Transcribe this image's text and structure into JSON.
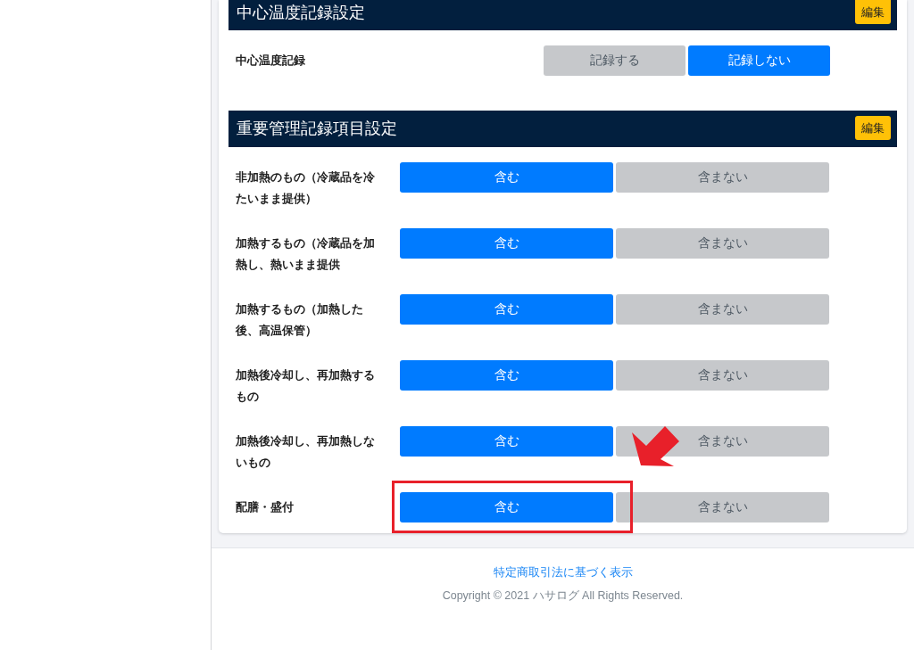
{
  "sections": [
    {
      "kind": "narrow",
      "title": "中心温度記録設定",
      "edit_button": "編集",
      "rows": [
        {
          "label": "中心温度記録",
          "options": [
            {
              "label": "記録する",
              "selected": false
            },
            {
              "label": "記録しない",
              "selected": true
            }
          ]
        }
      ]
    },
    {
      "kind": "wide",
      "title": "重要管理記録項目設定",
      "edit_button": "編集",
      "rows": [
        {
          "label": "非加熱のもの（冷蔵品を冷たいまま提供）",
          "options": [
            {
              "label": "含む",
              "selected": true
            },
            {
              "label": "含まない",
              "selected": false
            }
          ]
        },
        {
          "label": "加熱するもの（冷蔵品を加熱し、熱いまま提供",
          "options": [
            {
              "label": "含む",
              "selected": true
            },
            {
              "label": "含まない",
              "selected": false
            }
          ]
        },
        {
          "label": "加熱するもの（加熱した後、高温保管）",
          "options": [
            {
              "label": "含む",
              "selected": true
            },
            {
              "label": "含まない",
              "selected": false
            }
          ]
        },
        {
          "label": "加熱後冷却し、再加熱するもの",
          "options": [
            {
              "label": "含む",
              "selected": true
            },
            {
              "label": "含まない",
              "selected": false
            }
          ]
        },
        {
          "label": "加熱後冷却し、再加熱しないもの",
          "options": [
            {
              "label": "含む",
              "selected": true
            },
            {
              "label": "含まない",
              "selected": false
            }
          ]
        },
        {
          "label": "配膳・盛付",
          "options": [
            {
              "label": "含む",
              "selected": true
            },
            {
              "label": "含まない",
              "selected": false
            }
          ]
        }
      ]
    }
  ],
  "footer": {
    "link": "特定商取引法に基づく表示",
    "copyright": "Copyright © 2021 ハサログ All Rights Reserved."
  }
}
